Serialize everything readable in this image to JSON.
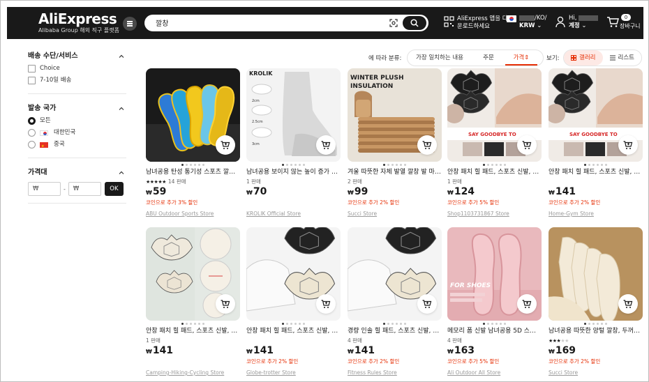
{
  "header": {
    "logo": "AliExpress",
    "logo_sub": "Alibaba Group 해외 직구 플랫폼",
    "search_query": "깔창",
    "app_line1": "AliExpress 앱을 다",
    "app_line2": "운로드하세요",
    "locale_line1": "/KO/",
    "locale_line2": "KRW",
    "user_line1": "Hi,",
    "user_line2": "계정",
    "cart_count": "0",
    "cart_label": "장바구니"
  },
  "sidebar": {
    "shipping_title": "배송 수단/서비스",
    "shipping_options": [
      "Choice",
      "7-10일 배송"
    ],
    "origin_title": "발송 국가",
    "origin_options": [
      "모든",
      "대한민국",
      "중국"
    ],
    "price_title": "가격대",
    "price_min_placeholder": "₩",
    "price_max_placeholder": "₩",
    "ok_label": "OK"
  },
  "sortbar": {
    "label": "에 따라 분류:",
    "options": [
      "가장 일치하는 내용",
      "주문",
      "가격"
    ],
    "active": "가격",
    "view_label": "보기:",
    "view_options": [
      "갤러리",
      "리스트"
    ],
    "view_active": "갤러리"
  },
  "colors": {
    "accent": "#e62e04",
    "header_bg": "#191919"
  },
  "products": [
    {
      "title": "남녀공용 탄성 통기성 스포츠 깔창, 충격 흡수",
      "sold": "14 판매",
      "stars": 5,
      "currency": "₩",
      "price": "59",
      "promo": "코인으로 추가 3% 할인",
      "store": "ABU Outdoor Sports Store"
    },
    {
      "title": "남녀공용 보이지 않는 높이 증가 깔창",
      "sold": "1 판매",
      "stars": 0,
      "currency": "₩",
      "price": "70",
      "promo": "",
      "store": "KROLIK Official Store"
    },
    {
      "title": "겨울 따뜻한 자체 발열 깔창 발 마사지",
      "sold": "2 판매",
      "stars": 0,
      "currency": "₩",
      "price": "99",
      "promo": "코인으로 추가 2% 할인",
      "store": "Succi Store"
    },
    {
      "title": "안창 패치 힐 패드, 스포츠 신발, 조절 가능",
      "sold": "1 판매",
      "stars": 0,
      "currency": "₩",
      "price": "124",
      "promo": "코인으로 추가 5% 할인",
      "store": "Shop1103731867 Store"
    },
    {
      "title": "안창 패치 힐 패드, 스포츠 신발, 조절 가능",
      "sold": "",
      "stars": 0,
      "currency": "₩",
      "price": "141",
      "promo": "코인으로 추가 2% 할인",
      "store": "Home-Gym Store"
    },
    {
      "title": "안창 패치 힐 패드, 스포츠 신발, 조절 가능",
      "sold": "1 판매",
      "stars": 0,
      "currency": "₩",
      "price": "141",
      "promo": "",
      "store": "Camping-Hiking-Cycling Store"
    },
    {
      "title": "안창 패치 힐 패드, 스포츠 신발, 조절 가능",
      "sold": "",
      "stars": 0,
      "currency": "₩",
      "price": "141",
      "promo": "코인으로 추가 2% 할인",
      "store": "Globe-trotter Store"
    },
    {
      "title": "경량 인솔 힐 패드, 스포츠 신발, 조절 가능",
      "sold": "4 판매",
      "stars": 0,
      "currency": "₩",
      "price": "141",
      "promo": "코인으로 추가 2% 할인",
      "store": "Fitness Rules Store"
    },
    {
      "title": "메모리 폼 신발 남녀공용 5D 스포츠 깔창",
      "sold": "4 판매",
      "stars": 0,
      "currency": "₩",
      "price": "163",
      "promo": "코인으로 추가 5% 할인",
      "store": "Ali Outdoor All Store"
    },
    {
      "title": "남녀공용 따뜻한 양털 깔창, 두꺼운 겨울",
      "sold": "",
      "stars": 3,
      "currency": "₩",
      "price": "169",
      "promo": "코인으로 추가 2% 할인",
      "store": "Succi Store"
    }
  ],
  "thumb_texts": {
    "p1": "KROLIK",
    "p2_a": "WINTER PLUSH",
    "p2_b": "INSULATION",
    "p3": "SAY GOODBYE TO",
    "p8": "FOR SHOES"
  }
}
